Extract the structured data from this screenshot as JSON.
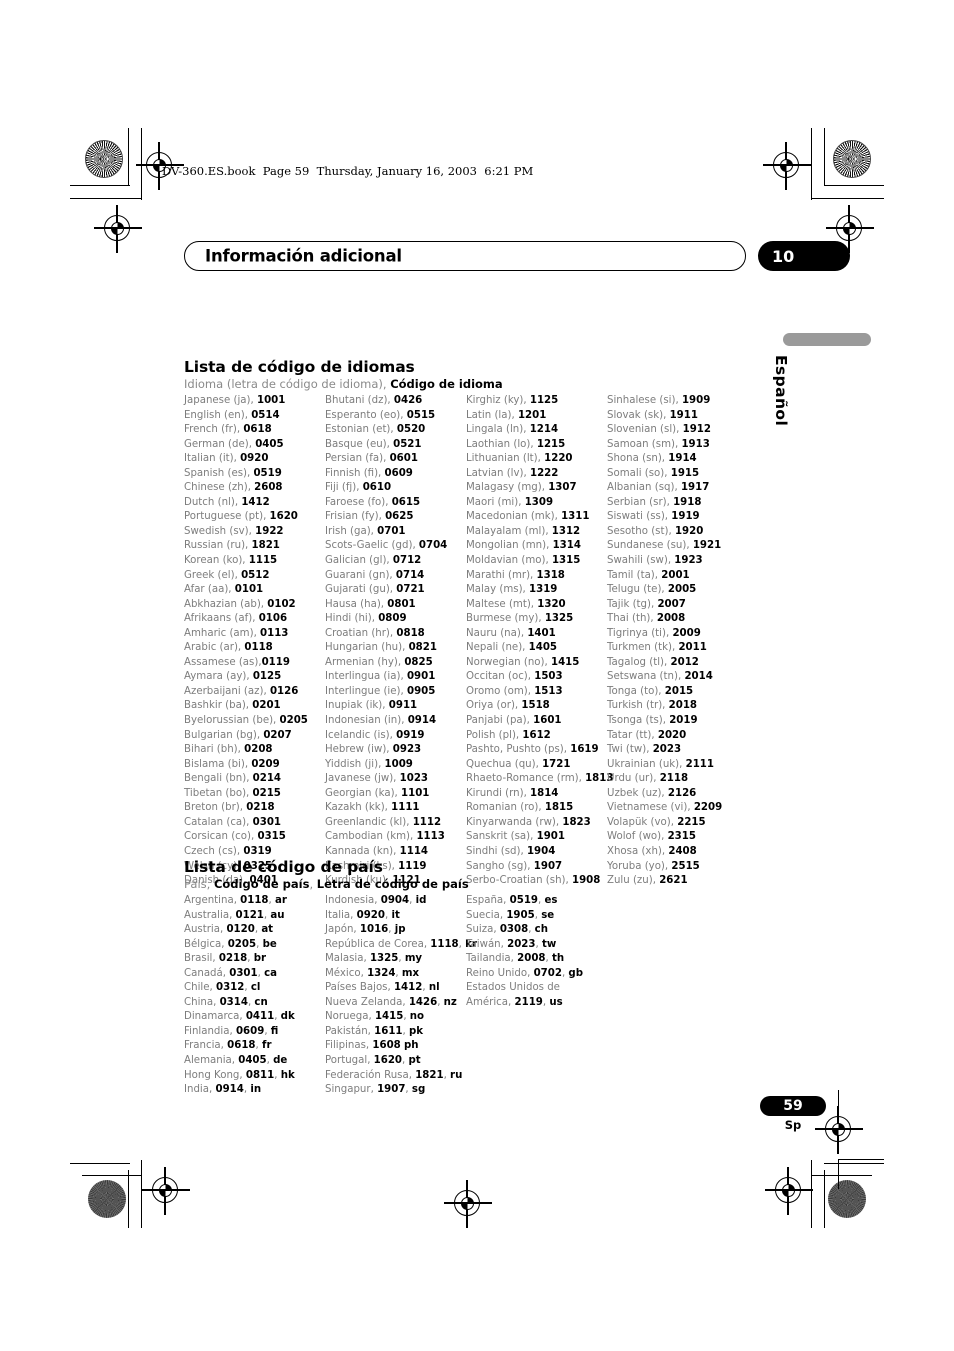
{
  "file_header": "DV-360.ES.book  Page 59  Thursday, January 16, 2003  6:21 PM",
  "chapter": {
    "title": "Información adicional",
    "number": "10"
  },
  "side_tab": {
    "label": "Español"
  },
  "footer": {
    "page_number": "59",
    "language_mark": "Sp"
  },
  "language_section": {
    "title": "Lista de código de idiomas",
    "legend_plain": "Idioma (letra de código de idioma), ",
    "legend_bold": "Código de idioma",
    "columns": [
      [
        {
          "name": "Japanese (ja), ",
          "code": "1001"
        },
        {
          "name": "English (en), ",
          "code": "0514"
        },
        {
          "name": "French (fr), ",
          "code": "0618"
        },
        {
          "name": "German (de), ",
          "code": "0405"
        },
        {
          "name": "Italian (it), ",
          "code": "0920"
        },
        {
          "name": "Spanish (es), ",
          "code": "0519"
        },
        {
          "name": "Chinese (zh), ",
          "code": "2608"
        },
        {
          "name": "Dutch (nl), ",
          "code": "1412"
        },
        {
          "name": "Portuguese (pt), ",
          "code": "1620"
        },
        {
          "name": "Swedish (sv), ",
          "code": "1922"
        },
        {
          "name": "Russian (ru), ",
          "code": "1821"
        },
        {
          "name": "Korean (ko), ",
          "code": "1115"
        },
        {
          "name": "Greek (el), ",
          "code": "0512"
        },
        {
          "name": "Afar (aa), ",
          "code": "0101"
        },
        {
          "name": "Abkhazian (ab), ",
          "code": "0102"
        },
        {
          "name": "Afrikaans (af), ",
          "code": "0106"
        },
        {
          "name": "Amharic (am), ",
          "code": "0113"
        },
        {
          "name": "Arabic (ar), ",
          "code": "0118"
        },
        {
          "name": "Assamese (as),",
          "code": "0119"
        },
        {
          "name": "Aymara (ay), ",
          "code": "0125"
        },
        {
          "name": "Azerbaijani (az), ",
          "code": "0126"
        },
        {
          "name": "Bashkir (ba), ",
          "code": "0201"
        },
        {
          "name": "Byelorussian (be), ",
          "code": "0205"
        },
        {
          "name": "Bulgarian (bg), ",
          "code": "0207"
        },
        {
          "name": "Bihari (bh), ",
          "code": "0208"
        },
        {
          "name": "Bislama (bi), ",
          "code": "0209"
        },
        {
          "name": "Bengali (bn), ",
          "code": "0214"
        },
        {
          "name": "Tibetan (bo), ",
          "code": "0215"
        },
        {
          "name": "Breton (br), ",
          "code": "0218"
        },
        {
          "name": "Catalan (ca), ",
          "code": "0301"
        },
        {
          "name": "Corsican (co), ",
          "code": "0315"
        },
        {
          "name": "Czech (cs), ",
          "code": "0319"
        },
        {
          "name": "Welsh (cy), ",
          "code": "0325"
        },
        {
          "name": "Danish (da), ",
          "code": "0401"
        }
      ],
      [
        {
          "name": "Bhutani (dz), ",
          "code": "0426"
        },
        {
          "name": "Esperanto (eo), ",
          "code": "0515"
        },
        {
          "name": "Estonian (et), ",
          "code": "0520"
        },
        {
          "name": "Basque (eu), ",
          "code": "0521"
        },
        {
          "name": "Persian (fa), ",
          "code": "0601"
        },
        {
          "name": "Finnish (fi), ",
          "code": "0609"
        },
        {
          "name": "Fiji (fj), ",
          "code": "0610"
        },
        {
          "name": "Faroese (fo), ",
          "code": "0615"
        },
        {
          "name": "Frisian (fy), ",
          "code": "0625"
        },
        {
          "name": "Irish (ga), ",
          "code": "0701"
        },
        {
          "name": "Scots-Gaelic (gd), ",
          "code": "0704"
        },
        {
          "name": "Galician (gl), ",
          "code": "0712"
        },
        {
          "name": "Guarani (gn), ",
          "code": "0714"
        },
        {
          "name": "Gujarati (gu), ",
          "code": "0721"
        },
        {
          "name": "Hausa (ha), ",
          "code": "0801"
        },
        {
          "name": "Hindi (hi), ",
          "code": "0809"
        },
        {
          "name": "Croatian (hr), ",
          "code": "0818"
        },
        {
          "name": "Hungarian (hu), ",
          "code": "0821"
        },
        {
          "name": "Armenian (hy), ",
          "code": "0825"
        },
        {
          "name": "Interlingua (ia), ",
          "code": "0901"
        },
        {
          "name": "Interlingue (ie), ",
          "code": "0905"
        },
        {
          "name": "Inupiak (ik), ",
          "code": "0911"
        },
        {
          "name": "Indonesian (in), ",
          "code": "0914"
        },
        {
          "name": "Icelandic (is), ",
          "code": "0919"
        },
        {
          "name": "Hebrew (iw), ",
          "code": "0923"
        },
        {
          "name": "Yiddish (ji), ",
          "code": "1009"
        },
        {
          "name": "Javanese (jw), ",
          "code": "1023"
        },
        {
          "name": "Georgian (ka), ",
          "code": "1101"
        },
        {
          "name": "Kazakh (kk), ",
          "code": "1111"
        },
        {
          "name": "Greenlandic (kl), ",
          "code": "1112"
        },
        {
          "name": "Cambodian (km), ",
          "code": "1113"
        },
        {
          "name": "Kannada (kn), ",
          "code": "1114"
        },
        {
          "name": "Kashmiri (ks), ",
          "code": "1119"
        },
        {
          "name": "Kurdish (ku), ",
          "code": "1121"
        }
      ],
      [
        {
          "name": "Kirghiz (ky), ",
          "code": "1125"
        },
        {
          "name": "Latin (la), ",
          "code": "1201"
        },
        {
          "name": "Lingala (ln), ",
          "code": "1214"
        },
        {
          "name": "Laothian (lo), ",
          "code": "1215"
        },
        {
          "name": "Lithuanian (lt), ",
          "code": "1220"
        },
        {
          "name": "Latvian (lv), ",
          "code": "1222"
        },
        {
          "name": "Malagasy (mg), ",
          "code": "1307"
        },
        {
          "name": "Maori (mi), ",
          "code": "1309"
        },
        {
          "name": "Macedonian (mk), ",
          "code": "1311"
        },
        {
          "name": "Malayalam (ml), ",
          "code": "1312"
        },
        {
          "name": "Mongolian (mn), ",
          "code": "1314"
        },
        {
          "name": "Moldavian (mo), ",
          "code": "1315"
        },
        {
          "name": "Marathi (mr), ",
          "code": "1318"
        },
        {
          "name": "Malay (ms), ",
          "code": "1319"
        },
        {
          "name": "Maltese (mt), ",
          "code": "1320"
        },
        {
          "name": "Burmese (my), ",
          "code": "1325"
        },
        {
          "name": "Nauru (na), ",
          "code": "1401"
        },
        {
          "name": "Nepali (ne), ",
          "code": "1405"
        },
        {
          "name": "Norwegian (no), ",
          "code": "1415"
        },
        {
          "name": "Occitan (oc), ",
          "code": "1503"
        },
        {
          "name": "Oromo (om), ",
          "code": "1513"
        },
        {
          "name": "Oriya (or), ",
          "code": "1518"
        },
        {
          "name": "Panjabi (pa), ",
          "code": "1601"
        },
        {
          "name": "Polish (pl), ",
          "code": "1612"
        },
        {
          "name": "Pashto, Pushto (ps), ",
          "code": "1619"
        },
        {
          "name": "Quechua (qu), ",
          "code": "1721"
        },
        {
          "name": "Rhaeto-Romance (rm), ",
          "code": "1813"
        },
        {
          "name": "Kirundi (rn), ",
          "code": "1814"
        },
        {
          "name": "Romanian (ro), ",
          "code": "1815"
        },
        {
          "name": "Kinyarwanda (rw), ",
          "code": "1823"
        },
        {
          "name": "Sanskrit (sa), ",
          "code": "1901"
        },
        {
          "name": "Sindhi (sd), ",
          "code": "1904"
        },
        {
          "name": "Sangho (sg), ",
          "code": "1907"
        },
        {
          "name": "Serbo-Croatian (sh), ",
          "code": "1908"
        }
      ],
      [
        {
          "name": "Sinhalese (si), ",
          "code": "1909"
        },
        {
          "name": "Slovak (sk), ",
          "code": "1911"
        },
        {
          "name": "Slovenian (sl), ",
          "code": "1912"
        },
        {
          "name": "Samoan (sm), ",
          "code": "1913"
        },
        {
          "name": "Shona (sn), ",
          "code": "1914"
        },
        {
          "name": "Somali (so), ",
          "code": "1915"
        },
        {
          "name": "Albanian (sq), ",
          "code": "1917"
        },
        {
          "name": "Serbian (sr), ",
          "code": "1918"
        },
        {
          "name": "Siswati (ss), ",
          "code": "1919"
        },
        {
          "name": "Sesotho (st), ",
          "code": "1920"
        },
        {
          "name": "Sundanese (su), ",
          "code": "1921"
        },
        {
          "name": "Swahili (sw), ",
          "code": "1923"
        },
        {
          "name": "Tamil (ta), ",
          "code": "2001"
        },
        {
          "name": "Telugu (te), ",
          "code": "2005"
        },
        {
          "name": "Tajik (tg), ",
          "code": "2007"
        },
        {
          "name": "Thai (th), ",
          "code": "2008"
        },
        {
          "name": "Tigrinya (ti), ",
          "code": "2009"
        },
        {
          "name": "Turkmen (tk), ",
          "code": "2011"
        },
        {
          "name": "Tagalog (tl), ",
          "code": "2012"
        },
        {
          "name": "Setswana (tn), ",
          "code": "2014"
        },
        {
          "name": "Tonga (to), ",
          "code": "2015"
        },
        {
          "name": "Turkish (tr), ",
          "code": "2018"
        },
        {
          "name": "Tsonga (ts), ",
          "code": "2019"
        },
        {
          "name": "Tatar (tt), ",
          "code": "2020"
        },
        {
          "name": "Twi (tw), ",
          "code": "2023"
        },
        {
          "name": "Ukrainian (uk), ",
          "code": "2111"
        },
        {
          "name": "Urdu (ur), ",
          "code": "2118"
        },
        {
          "name": "Uzbek (uz), ",
          "code": "2126"
        },
        {
          "name": "Vietnamese (vi), ",
          "code": "2209"
        },
        {
          "name": "Volapük (vo), ",
          "code": "2215"
        },
        {
          "name": "Wolof (wo), ",
          "code": "2315"
        },
        {
          "name": "Xhosa (xh), ",
          "code": "2408"
        },
        {
          "name": "Yoruba (yo), ",
          "code": "2515"
        },
        {
          "name": "Zulu (zu), ",
          "code": "2621"
        }
      ]
    ]
  },
  "country_section": {
    "title": "Lista de código de país",
    "legend_plain_1": "País, ",
    "legend_bold_1": "Código de país",
    "legend_plain_2": ", ",
    "legend_bold_2": "Letra de código de país",
    "columns": [
      [
        {
          "name": "Argentina, ",
          "code": "0118",
          "sep": ", ",
          "letter": "ar"
        },
        {
          "name": "Australia, ",
          "code": "0121",
          "sep": ", ",
          "letter": "au"
        },
        {
          "name": "Austria, ",
          "code": "0120",
          "sep": ", ",
          "letter": "at"
        },
        {
          "name": "Bélgica, ",
          "code": "0205",
          "sep": ", ",
          "letter": "be"
        },
        {
          "name": "Brasil, ",
          "code": "0218",
          "sep": ", ",
          "letter": "br"
        },
        {
          "name": "Canadá, ",
          "code": "0301",
          "sep": ", ",
          "letter": "ca"
        },
        {
          "name": "Chile, ",
          "code": "0312",
          "sep": ", ",
          "letter": "cl"
        },
        {
          "name": "China, ",
          "code": "0314",
          "sep": ", ",
          "letter": "cn"
        },
        {
          "name": "Dinamarca, ",
          "code": "0411",
          "sep": ", ",
          "letter": "dk"
        },
        {
          "name": "Finlandia, ",
          "code": "0609",
          "sep": ", ",
          "letter": "fi"
        },
        {
          "name": "Francia, ",
          "code": "0618",
          "sep": ", ",
          "letter": "fr"
        },
        {
          "name": "Alemania, ",
          "code": "0405",
          "sep": ", ",
          "letter": "de"
        },
        {
          "name": "Hong Kong, ",
          "code": "0811",
          "sep": ", ",
          "letter": "hk"
        },
        {
          "name": "India, ",
          "code": "0914",
          "sep": ", ",
          "letter": "in"
        }
      ],
      [
        {
          "name": "Indonesia, ",
          "code": "0904",
          "sep": ", ",
          "letter": "id"
        },
        {
          "name": "Italia, ",
          "code": "0920",
          "sep": ", ",
          "letter": "it"
        },
        {
          "name": "Japón, ",
          "code": "1016",
          "sep": ", ",
          "letter": "jp"
        },
        {
          "name": "República de Corea, ",
          "code": "1118",
          "sep": ", ",
          "letter": "kr"
        },
        {
          "name": "Malasia, ",
          "code": "1325",
          "sep": ", ",
          "letter": "my"
        },
        {
          "name": "México, ",
          "code": "1324",
          "sep": ", ",
          "letter": "mx"
        },
        {
          "name": "Países Bajos, ",
          "code": "1412",
          "sep": ", ",
          "letter": "nl"
        },
        {
          "name": "Nueva Zelanda, ",
          "code": "1426",
          "sep": ", ",
          "letter": "nz"
        },
        {
          "name": "Noruega, ",
          "code": "1415",
          "sep": ", ",
          "letter": "no"
        },
        {
          "name": "Pakistán, ",
          "code": "1611",
          "sep": ", ",
          "letter": "pk"
        },
        {
          "name": "Filipinas, ",
          "code": "1608",
          "sep": " ",
          "letter": "ph"
        },
        {
          "name": "Portugal, ",
          "code": "1620",
          "sep": ", ",
          "letter": "pt"
        },
        {
          "name": "Federación Rusa, ",
          "code": "1821",
          "sep": ", ",
          "letter": "ru"
        },
        {
          "name": "Singapur, ",
          "code": "1907",
          "sep": ", ",
          "letter": "sg"
        }
      ],
      [
        {
          "name": "España, ",
          "code": "0519",
          "sep": ", ",
          "letter": "es"
        },
        {
          "name": "Suecia, ",
          "code": "1905",
          "sep": ", ",
          "letter": "se"
        },
        {
          "name": "Suiza, ",
          "code": "0308",
          "sep": ", ",
          "letter": "ch"
        },
        {
          "name": "Taiwán, ",
          "code": "2023",
          "sep": ", ",
          "letter": "tw"
        },
        {
          "name": "Tailandia, ",
          "code": "2008",
          "sep": ", ",
          "letter": "th"
        },
        {
          "name": "Reino Unido, ",
          "code": "0702",
          "sep": ", ",
          "letter": "gb"
        },
        {
          "name": "Estados Unidos de",
          "code": "",
          "sep": "",
          "letter": ""
        },
        {
          "name": "América, ",
          "code": "2119",
          "sep": ", ",
          "letter": "us"
        }
      ]
    ]
  }
}
